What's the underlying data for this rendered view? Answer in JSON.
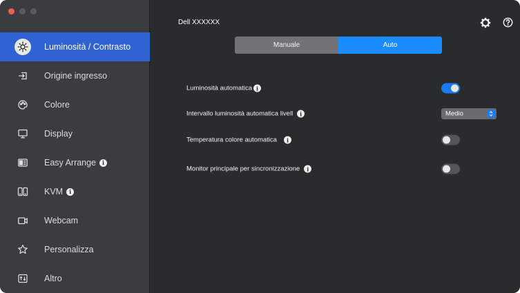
{
  "header": {
    "title": "Dell XXXXXX"
  },
  "colors": {
    "accent": "#1a8cff",
    "active_nav": "#2f63d3",
    "sidebar_bg": "#3b3c3f",
    "main_bg": "#2a2b2d"
  },
  "sidebar": {
    "items": [
      {
        "label": "Luminosità / Contrasto",
        "icon": "brightness-icon",
        "active": true
      },
      {
        "label": "Origine ingresso",
        "icon": "input-source-icon"
      },
      {
        "label": "Colore",
        "icon": "color-palette-icon"
      },
      {
        "label": "Display",
        "icon": "display-icon"
      },
      {
        "label": "Easy Arrange",
        "icon": "easy-arrange-icon",
        "info": true
      },
      {
        "label": "KVM",
        "icon": "kvm-icon",
        "info": true
      },
      {
        "label": "Webcam",
        "icon": "webcam-icon"
      },
      {
        "label": "Personalizza",
        "icon": "star-icon"
      },
      {
        "label": "Altro",
        "icon": "other-icon"
      }
    ]
  },
  "mode": {
    "manual_label": "Manuale",
    "auto_label": "Auto",
    "selected": "Auto"
  },
  "settings": {
    "auto_brightness": {
      "label": "Luminosità automatica",
      "enabled": true
    },
    "auto_brightness_range": {
      "label": "Intervallo luminosità automatica livell",
      "value": "Medio"
    },
    "auto_color_temp": {
      "label": "Temperatura colore automatica",
      "enabled": false
    },
    "primary_monitor_sync": {
      "label": "Monitor principale per sincronizzazione",
      "enabled": false
    }
  },
  "info_glyph": "i"
}
